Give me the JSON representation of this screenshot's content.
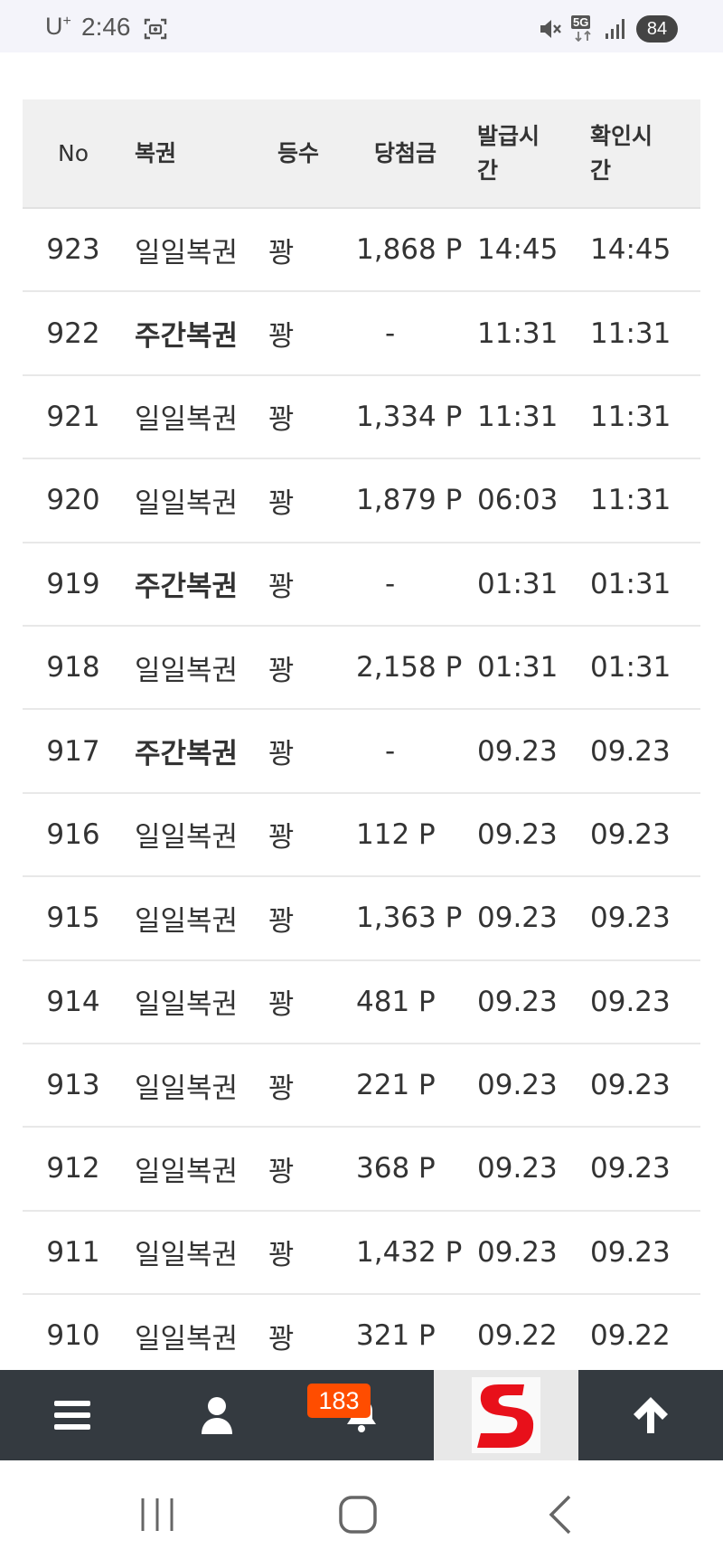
{
  "status_bar": {
    "carrier": "U",
    "carrier_sup": "+",
    "time": "2:46",
    "network": "5G",
    "battery": "84"
  },
  "table": {
    "headers": {
      "no": "No",
      "type": "복권",
      "rank": "등수",
      "prize": "당첨금",
      "issued_line1": "발급시",
      "issued_line2": "간",
      "checked_line1": "확인시",
      "checked_line2": "간"
    },
    "rows": [
      {
        "no": "923",
        "type": "일일복권",
        "weekly": false,
        "rank": "꽝",
        "prize": "1,868 P",
        "issued": "14:45",
        "checked": "14:45"
      },
      {
        "no": "922",
        "type": "주간복권",
        "weekly": true,
        "rank": "꽝",
        "prize": "-",
        "issued": "11:31",
        "checked": "11:31"
      },
      {
        "no": "921",
        "type": "일일복권",
        "weekly": false,
        "rank": "꽝",
        "prize": "1,334 P",
        "issued": "11:31",
        "checked": "11:31"
      },
      {
        "no": "920",
        "type": "일일복권",
        "weekly": false,
        "rank": "꽝",
        "prize": "1,879 P",
        "issued": "06:03",
        "checked": "11:31"
      },
      {
        "no": "919",
        "type": "주간복권",
        "weekly": true,
        "rank": "꽝",
        "prize": "-",
        "issued": "01:31",
        "checked": "01:31"
      },
      {
        "no": "918",
        "type": "일일복권",
        "weekly": false,
        "rank": "꽝",
        "prize": "2,158 P",
        "issued": "01:31",
        "checked": "01:31"
      },
      {
        "no": "917",
        "type": "주간복권",
        "weekly": true,
        "rank": "꽝",
        "prize": "-",
        "issued": "09.23",
        "checked": "09.23"
      },
      {
        "no": "916",
        "type": "일일복권",
        "weekly": false,
        "rank": "꽝",
        "prize": "112 P",
        "issued": "09.23",
        "checked": "09.23"
      },
      {
        "no": "915",
        "type": "일일복권",
        "weekly": false,
        "rank": "꽝",
        "prize": "1,363 P",
        "issued": "09.23",
        "checked": "09.23"
      },
      {
        "no": "914",
        "type": "일일복권",
        "weekly": false,
        "rank": "꽝",
        "prize": "481 P",
        "issued": "09.23",
        "checked": "09.23"
      },
      {
        "no": "913",
        "type": "일일복권",
        "weekly": false,
        "rank": "꽝",
        "prize": "221 P",
        "issued": "09.23",
        "checked": "09.23"
      },
      {
        "no": "912",
        "type": "일일복권",
        "weekly": false,
        "rank": "꽝",
        "prize": "368 P",
        "issued": "09.23",
        "checked": "09.23"
      },
      {
        "no": "911",
        "type": "일일복권",
        "weekly": false,
        "rank": "꽝",
        "prize": "1,432 P",
        "issued": "09.23",
        "checked": "09.23"
      },
      {
        "no": "910",
        "type": "일일복권",
        "weekly": false,
        "rank": "꽝",
        "prize": "321 P",
        "issued": "09.22",
        "checked": "09.22"
      }
    ]
  },
  "bottom_nav": {
    "notification_count": "183",
    "icons": [
      "menu-icon",
      "user-icon",
      "bell-icon",
      "site-logo",
      "arrow-up-icon"
    ]
  },
  "colors": {
    "nav_bg": "#343a40",
    "badge_bg": "#ff4d00",
    "header_bg": "#f0f0f0",
    "logo_red": "#e8101a"
  }
}
